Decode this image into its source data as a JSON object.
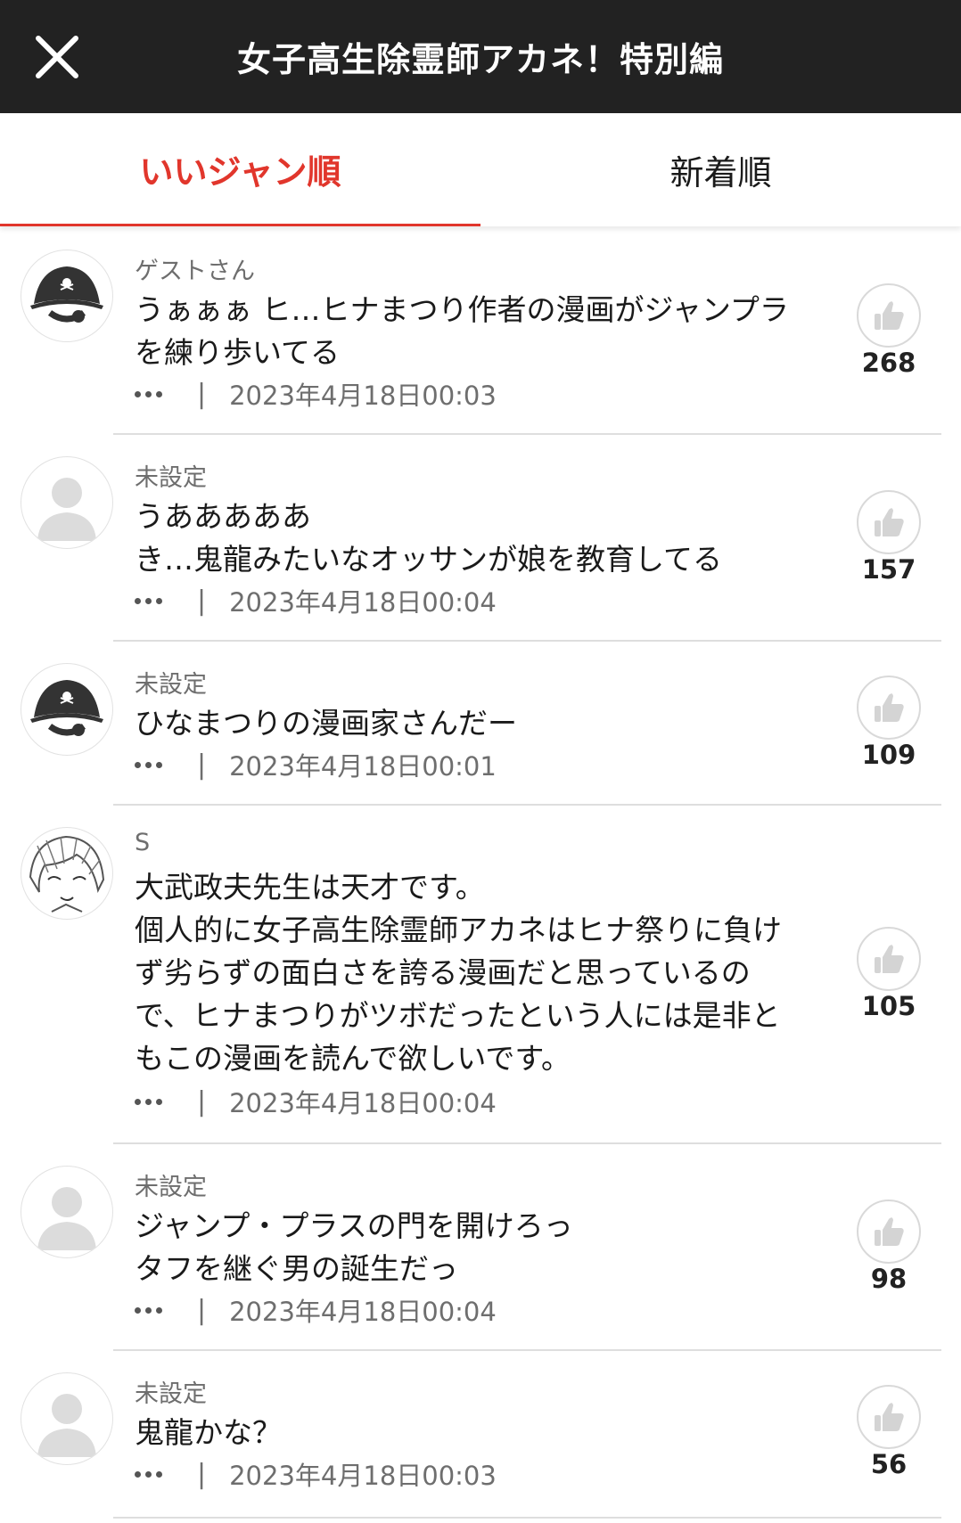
{
  "header": {
    "title": "女子高生除霊師アカネ！特別編",
    "close_icon": "close-icon"
  },
  "tabs": [
    {
      "label": "いいジャン順",
      "active": true
    },
    {
      "label": "新着順",
      "active": false
    }
  ],
  "colors": {
    "accent": "#e1362c",
    "header_bg": "#222222",
    "muted_text": "#6e6e6e"
  },
  "comments": [
    {
      "author": "ゲストさん",
      "avatar": "pirate-avatar-icon",
      "text": "うぁぁぁ ヒ…ヒナまつり作者の漫画がジャンプラ\nを練り歩いてる",
      "date": "2023年4月18日00:03",
      "likes": "268"
    },
    {
      "author": "未設定",
      "avatar": "default-user-icon",
      "text": "うあああああ\nき…鬼龍みたいなオッサンが娘を教育してる",
      "date": "2023年4月18日00:04",
      "likes": "157"
    },
    {
      "author": "未設定",
      "avatar": "pirate-avatar-icon",
      "text": "ひなまつりの漫画家さんだー",
      "date": "2023年4月18日00:01",
      "likes": "109"
    },
    {
      "author": "S",
      "avatar": "manga-character-avatar",
      "text": "大武政夫先生は天才です。\n個人的に女子高生除霊師アカネはヒナ祭りに負け\nず劣らずの面白さを誇る漫画だと思っているの\nで、ヒナまつりがツボだったという人には是非と\nもこの漫画を読んで欲しいです。",
      "date": "2023年4月18日00:04",
      "likes": "105"
    },
    {
      "author": "未設定",
      "avatar": "default-user-icon",
      "text": "ジャンプ・プラスの門を開けろっ\nタフを継ぐ男の誕生だっ",
      "date": "2023年4月18日00:04",
      "likes": "98"
    },
    {
      "author": "未設定",
      "avatar": "default-user-icon",
      "text": "鬼龍かな？",
      "date": "2023年4月18日00:03",
      "likes": "56"
    }
  ]
}
